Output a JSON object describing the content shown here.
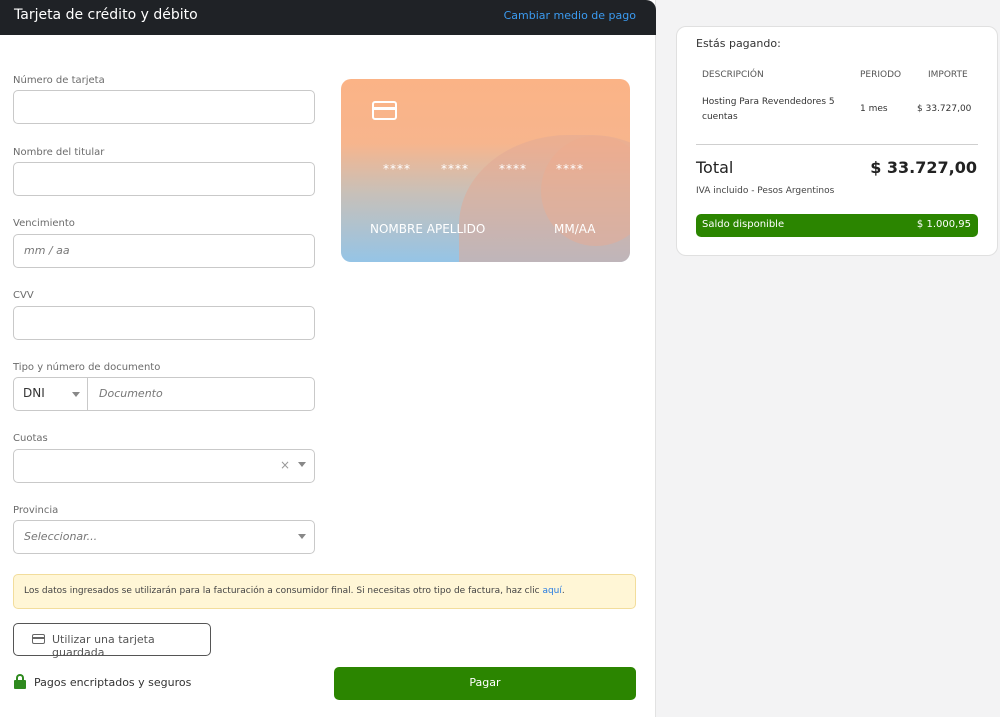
{
  "header": {
    "title": "Tarjeta de crédito y débito",
    "change_method": "Cambiar medio de pago"
  },
  "form": {
    "card_number": {
      "label": "Número de tarjeta",
      "value": "",
      "placeholder": ""
    },
    "holder_name": {
      "label": "Nombre del titular",
      "value": "",
      "placeholder": ""
    },
    "expiry": {
      "label": "Vencimiento",
      "value": "",
      "placeholder": "mm / aa"
    },
    "cvv": {
      "label": "CVV",
      "value": "",
      "placeholder": ""
    },
    "document": {
      "label": "Tipo y número de documento",
      "type_value": "DNI",
      "placeholder": "Documento"
    },
    "installments": {
      "label": "Cuotas",
      "value": ""
    },
    "province": {
      "label": "Provincia",
      "placeholder": "Seleccionar..."
    }
  },
  "card_preview": {
    "number_groups": [
      "****",
      "****",
      "****",
      "****"
    ],
    "name": "NOMBRE APELLIDO",
    "expiry": "MM/AA"
  },
  "notice": {
    "text": "Los datos ingresados se utilizarán para la facturación a consumidor final. Si necesitas otro tipo de factura, haz clic ",
    "link": "aquí",
    "end": "."
  },
  "saved_card_button": "Utilizar una tarjeta guardada",
  "secure_text": "Pagos encriptados y seguros",
  "pay_button": "Pagar",
  "summary": {
    "heading": "Estás pagando:",
    "columns": [
      "DESCRIPCIÓN",
      "PERIODO",
      "IMPORTE"
    ],
    "item": {
      "description_line1": "Hosting Para Revendedores 5",
      "description_line2": "cuentas",
      "period": "1 mes",
      "amount": "$ 33.727,00"
    },
    "total_label": "Total",
    "total_value": "$ 33.727,00",
    "tax_note": "IVA incluido - Pesos Argentinos",
    "balance_label": "Saldo disponible",
    "balance_value": "$ 1.000,95"
  },
  "colors": {
    "header_bg": "#1f2226",
    "link": "#3b9bf0",
    "primary_green": "#2b8500",
    "notice_bg": "#fff6d6"
  },
  "icons": [
    "credit-card-icon",
    "chevron-down-icon",
    "clear-icon",
    "saved-card-icon",
    "lock-icon"
  ]
}
